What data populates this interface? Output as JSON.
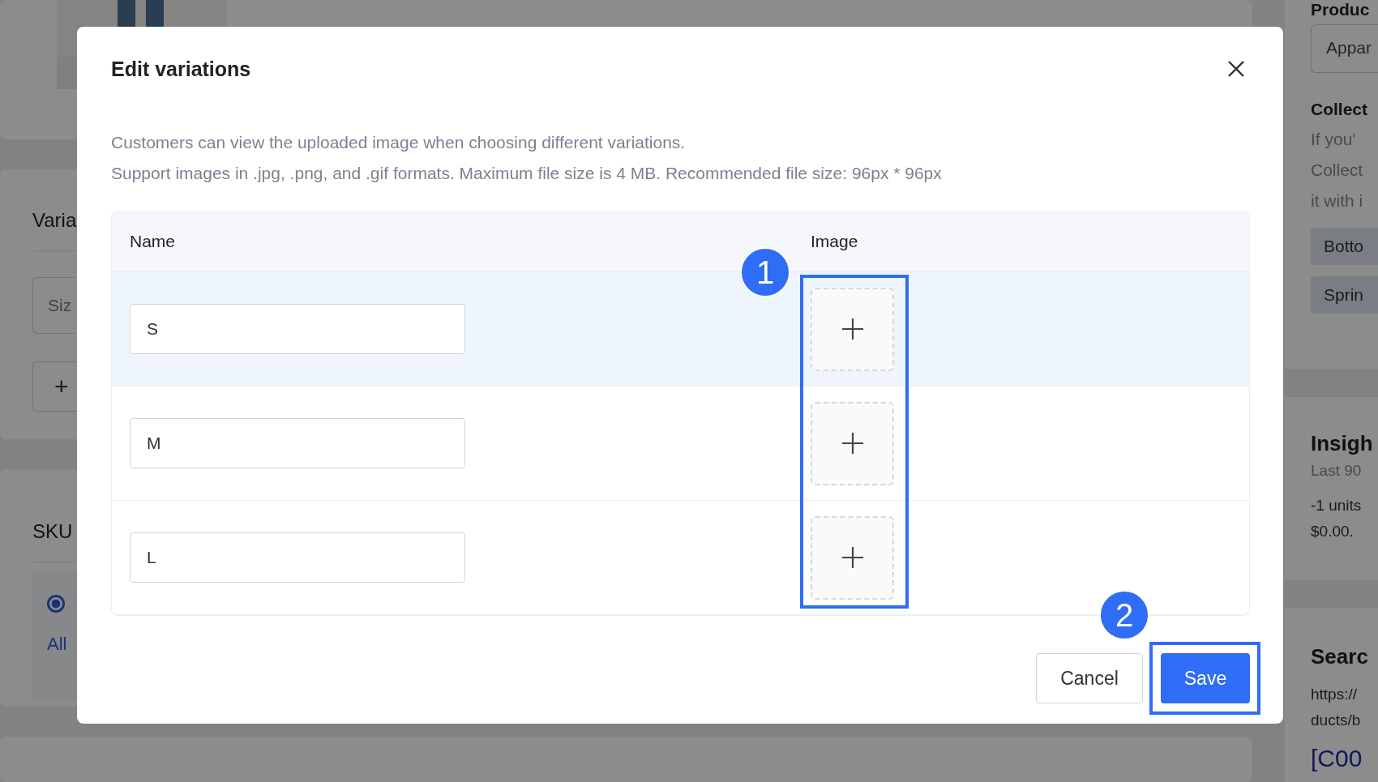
{
  "background": {
    "left": {
      "variations_title": "Varia",
      "option_field": "Siz",
      "add_icon": "+",
      "sku_title": "SKU",
      "sku_option": {
        "selected": true
      },
      "sku_link": "All"
    },
    "right": {
      "category_label": "Produc",
      "category_value": "Appar",
      "collections_title": "Collect",
      "collections_help": [
        "If you'",
        "Collect",
        "it with i"
      ],
      "collection_tags": [
        "Botto",
        "Sprin"
      ],
      "insights_title": "Insigh",
      "insights_period": "Last 90",
      "insights_text": [
        "-1 units",
        "$0.00."
      ],
      "search_title": "Searc",
      "search_url": [
        "https://",
        "ducts/b"
      ],
      "search_heading": "[C00"
    }
  },
  "dialog": {
    "title": "Edit variations",
    "description": [
      "Customers can view the uploaded image when choosing different variations.",
      "Support images in .jpg, .png, and .gif formats. Maximum file size is 4 MB. Recommended file size: 96px * 96px"
    ],
    "columns": [
      "Name",
      "Image"
    ],
    "rows": [
      {
        "name": "S",
        "selected": true
      },
      {
        "name": "M",
        "selected": false
      },
      {
        "name": "L",
        "selected": false
      }
    ],
    "buttons": [
      {
        "label": "Cancel",
        "kind": "secondary"
      },
      {
        "label": "Save",
        "kind": "primary"
      }
    ]
  },
  "annotations": [
    {
      "number": "1"
    },
    {
      "number": "2"
    }
  ]
}
